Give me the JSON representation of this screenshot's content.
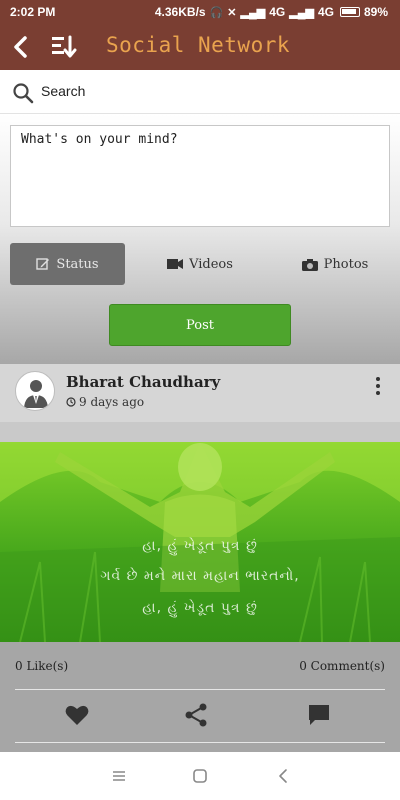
{
  "status_bar": {
    "time": "2:02 PM",
    "speed": "4.36KB/s",
    "net1": "4G",
    "net2": "4G",
    "battery": "89%"
  },
  "app_bar": {
    "title": "Social Network",
    "icons": [
      "back-arrow-icon",
      "sort-icon"
    ]
  },
  "search": {
    "label": "Search"
  },
  "compose": {
    "placeholder": "What's on your mind?",
    "tabs": [
      {
        "label": "Status",
        "icon": "edit-icon",
        "active": true
      },
      {
        "label": "Videos",
        "icon": "video-camera-icon",
        "active": false
      },
      {
        "label": "Photos",
        "icon": "camera-icon",
        "active": false
      }
    ],
    "post_label": "Post"
  },
  "post": {
    "author": "Bharat Chaudhary",
    "time": "9 days ago",
    "image_text": [
      "હા, હું ખેડૂત પુત્ર છું",
      "ગર્વ છે મને મારા મહાન ભારતનો,",
      "હા, હું ખેડૂત પુત્ર છું"
    ],
    "likes": "0 Like(s)",
    "comments": "0 Comment(s)"
  },
  "colors": {
    "app_bar": "#7a3e32",
    "title": "#e9a34e",
    "post_button": "#4ea52d",
    "active_tab": "#6e6e6e"
  }
}
